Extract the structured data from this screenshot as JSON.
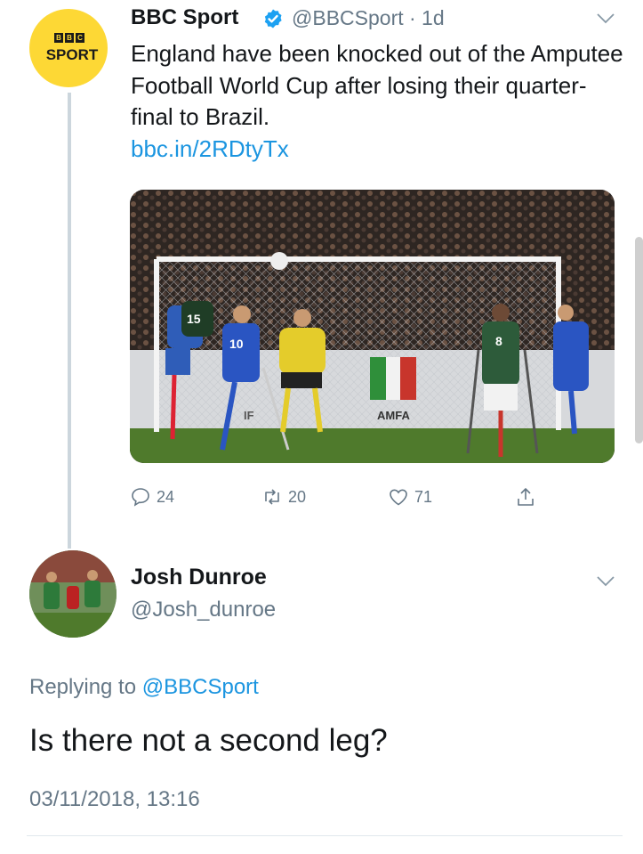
{
  "tweet": {
    "account_name": "BBC Sport",
    "handle_time": "@BBCSport · 1d",
    "avatar_logo": {
      "blocks": [
        "B",
        "B",
        "C"
      ],
      "word": "SPORT"
    },
    "text": "England have been knocked out of the Amputee Football World Cup after losing their quarter-final to Brazil.",
    "link": "bbc.in/2RDtyTx",
    "photo": {
      "jersey_numbers": [
        "15",
        "10",
        "8"
      ],
      "ad_boards": [
        "IF",
        "AMFA"
      ]
    },
    "actions": {
      "replies": "24",
      "retweets": "20",
      "likes": "71"
    }
  },
  "reply": {
    "name": "Josh Dunroe",
    "handle": "@Josh_dunroe",
    "replying_label": "Replying to",
    "replying_mention": "@BBCSport",
    "text": "Is there not a second leg?",
    "timestamp": "03/11/2018, 13:16"
  },
  "colors": {
    "link": "#1b95e0",
    "muted": "#657786",
    "bbc_yellow": "#fdd835",
    "thread_line": "#ccd6dd"
  },
  "icons": [
    "verified-icon",
    "chevron-down-icon",
    "reply-icon",
    "retweet-icon",
    "like-icon",
    "share-icon"
  ]
}
